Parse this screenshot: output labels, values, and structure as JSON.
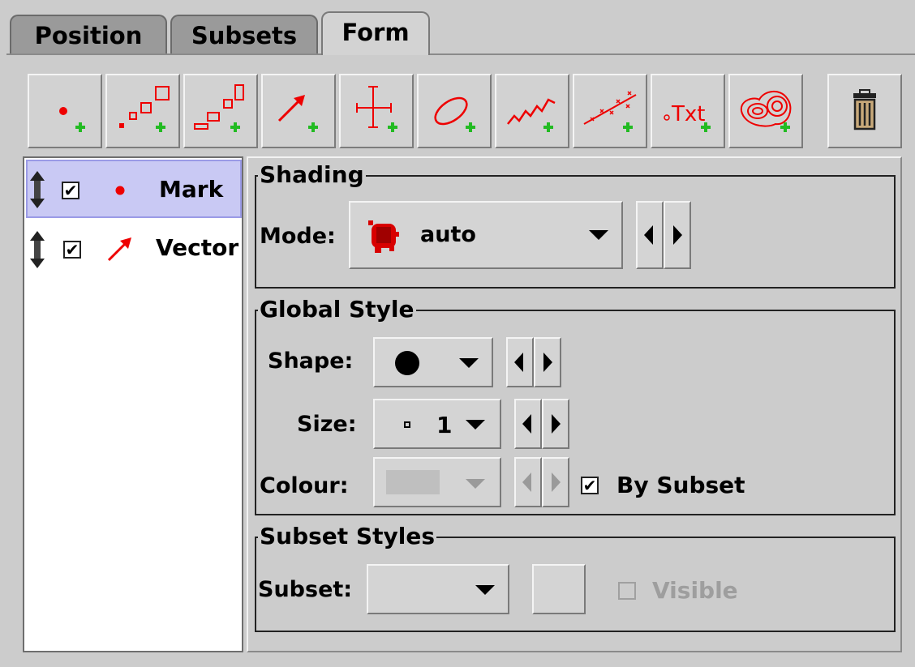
{
  "tabs": [
    {
      "label": "Position",
      "active": false
    },
    {
      "label": "Subsets",
      "active": false
    },
    {
      "label": "Form",
      "active": true
    }
  ],
  "toolbar": {
    "buttons": [
      {
        "icon": "add-mark-icon"
      },
      {
        "icon": "add-size-icon"
      },
      {
        "icon": "add-sizexy-icon"
      },
      {
        "icon": "add-vector-icon"
      },
      {
        "icon": "add-error-bars-icon"
      },
      {
        "icon": "add-ellipse-icon"
      },
      {
        "icon": "add-line-icon"
      },
      {
        "icon": "add-linear-fit-icon"
      },
      {
        "icon": "add-label-icon"
      },
      {
        "icon": "add-contour-icon"
      }
    ],
    "delete_icon": "trash-icon",
    "icon_color": "#ee0000",
    "plus_color": "#22bb22"
  },
  "layers": [
    {
      "label": "Mark",
      "checked": true,
      "selected": true,
      "icon": "mark-dot-icon"
    },
    {
      "label": "Vector",
      "checked": true,
      "selected": false,
      "icon": "vector-arrow-icon"
    }
  ],
  "shading": {
    "title": "Shading",
    "mode_label": "Mode:",
    "mode_value": "auto"
  },
  "global_style": {
    "title": "Global Style",
    "shape_label": "Shape:",
    "size_label": "Size:",
    "size_value": "1",
    "colour_label": "Colour:",
    "by_subset_label": "By Subset",
    "by_subset_checked": true
  },
  "subset_styles": {
    "title": "Subset Styles",
    "subset_label": "Subset:",
    "subset_value": "",
    "visible_label": "Visible",
    "visible_checked": false
  },
  "checkmark": "✔"
}
